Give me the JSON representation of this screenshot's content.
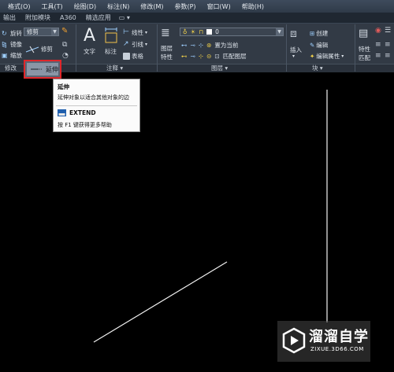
{
  "menu": [
    "格式(O)",
    "工具(T)",
    "绘图(D)",
    "标注(N)",
    "修改(M)",
    "参数(P)",
    "窗口(W)",
    "帮助(H)"
  ],
  "tabs": [
    "输出",
    "附加模块",
    "A360",
    "精选应用"
  ],
  "ribbon": {
    "modify_panel": {
      "rotate": "旋转",
      "mirror": "镜像",
      "scale": "缩放",
      "trim_combo": "修剪",
      "trim": "修剪",
      "extend": "延伸",
      "label": "修改"
    },
    "annotation_panel": {
      "text": "文字",
      "dimension": "标注",
      "linear": "线性",
      "leader": "引线",
      "table": "表格",
      "label": "注释"
    },
    "layers_panel": {
      "layer_props_1": "图层",
      "layer_props_2": "特性",
      "layer_value": "0",
      "set_current": "置为当前",
      "match_layer": "匹配图层",
      "label": "图层"
    },
    "block_panel": {
      "insert": "插入",
      "create": "创建",
      "edit": "编辑",
      "edit_attributes": "编辑属性",
      "label": "块"
    },
    "properties_panel": {
      "properties": "特性",
      "match": "匹配"
    }
  },
  "tooltip": {
    "title": "延伸",
    "description": "延伸对象以适合其他对象的边",
    "command": "EXTEND",
    "help": "按 F1 键获得更多帮助"
  },
  "watermark": {
    "name": "溜溜自学",
    "url": "ZIXUE.3D66.COM"
  },
  "colors": {
    "highlight": "#e0262a",
    "ribbon": "#323a45",
    "canvas": "#000000"
  }
}
